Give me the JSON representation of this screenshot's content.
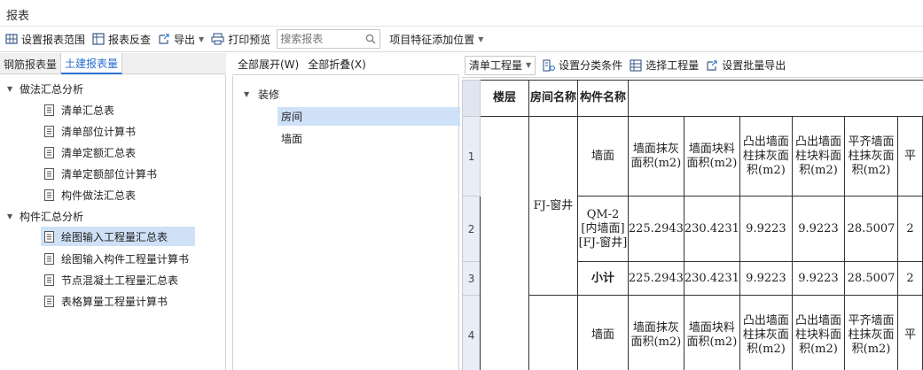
{
  "title": "报表",
  "toolbar": {
    "set_range": "设置报表范围",
    "review": "报表反查",
    "export": "导出",
    "print_preview": "打印预览",
    "search_placeholder": "搜索报表",
    "feature_position": "项目特征添加位置"
  },
  "left_tabs": {
    "rebar": "钢筋报表量",
    "civil": "土建报表量"
  },
  "tree": {
    "group1": "做法汇总分析",
    "g1_items": [
      "清单汇总表",
      "清单部位计算书",
      "清单定额汇总表",
      "清单定额部位计算书",
      "构件做法汇总表"
    ],
    "group2": "构件汇总分析",
    "g2_items": [
      "绘图输入工程量汇总表",
      "绘图输入构件工程量计算书",
      "节点混凝土工程量汇总表",
      "表格算量工程量计算书"
    ]
  },
  "middle": {
    "expand_all": "全部展开(W)",
    "collapse_all": "全部折叠(X)",
    "root": "装修",
    "items": [
      "房间",
      "墙面"
    ]
  },
  "right_toolbar": {
    "dropdown": "清单工程量",
    "set_category": "设置分类条件",
    "select_quantity": "选择工程量",
    "set_batch_export": "设置批量导出"
  },
  "grid": {
    "headers": {
      "floor": "楼层",
      "room": "房间名称",
      "component": "构件名称"
    },
    "row_numbers": [
      "1",
      "2",
      "3",
      "4"
    ],
    "room_value": "FJ-窗井",
    "component_wall": "墙面",
    "component_qm": "QM-2 [内墙面][FJ-窗井]",
    "subtotal": "小计",
    "qty_headers": [
      "墙面抹灰面积(m2)",
      "墙面块料面积(m2)",
      "凸出墙面柱抹灰面积(m2)",
      "凸出墙面柱块料面积(m2)",
      "平齐墙面柱抹灰面积(m2)",
      "平"
    ],
    "row2_values": [
      "225.2943",
      "230.4231",
      "9.9223",
      "9.9223",
      "28.5007",
      "2"
    ],
    "row3_values": [
      "225.2943",
      "230.4231",
      "9.9223",
      "9.9223",
      "28.5007",
      "2"
    ]
  }
}
